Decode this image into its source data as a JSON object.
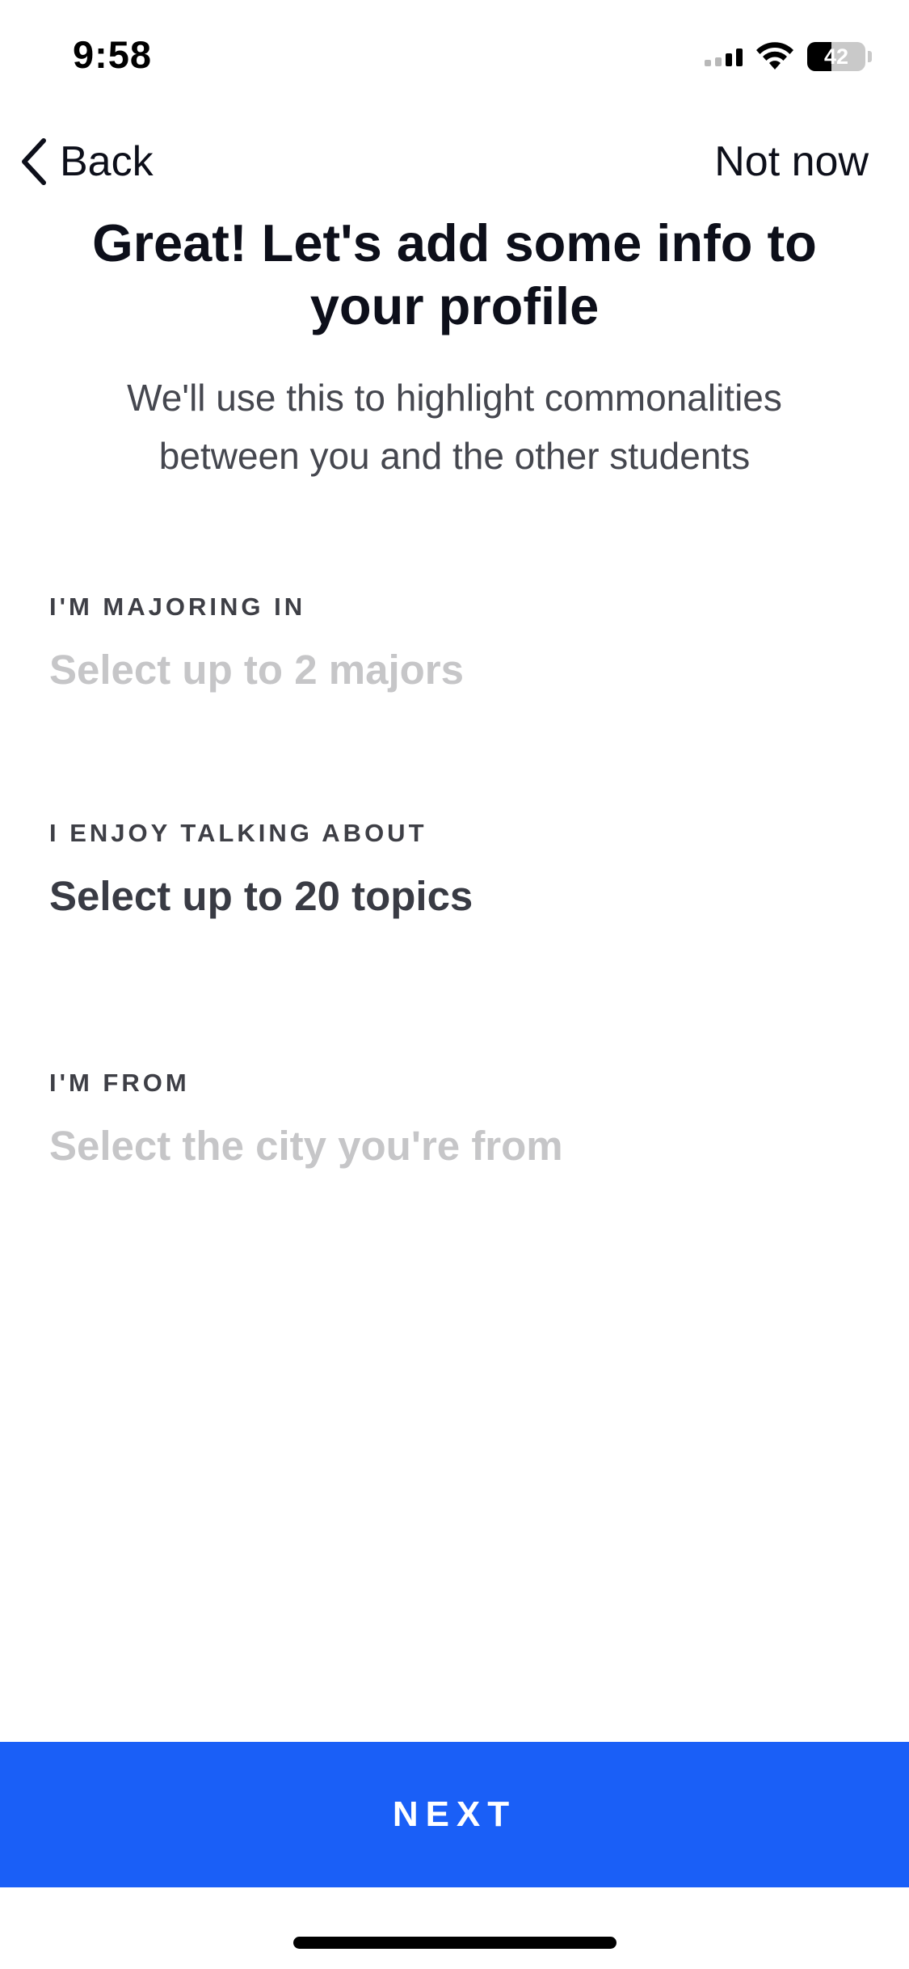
{
  "status_bar": {
    "time": "9:58",
    "battery_level": "42",
    "battery_fraction": 0.42,
    "icons": [
      "cellular-signal-icon",
      "wifi-icon",
      "battery-icon"
    ]
  },
  "nav": {
    "back_label": "Back",
    "back_icon": "chevron-left-icon",
    "skip_label": "Not now"
  },
  "header": {
    "title": "Great! Let's add some info to your profile",
    "subtitle": "We'll use this to highlight commonalities between you and the other students"
  },
  "fields": {
    "major": {
      "label": "I'M MAJORING IN",
      "placeholder": "Select up to 2 majors"
    },
    "topics": {
      "label": "I ENJOY TALKING ABOUT",
      "value": "Select up to 20 topics"
    },
    "hometown": {
      "label": "I'M FROM",
      "placeholder": "Select the city you're from"
    }
  },
  "footer": {
    "next_label": "NEXT"
  },
  "colors": {
    "primary": "#1a5ff7",
    "title_text": "#0d0f1a",
    "placeholder_text": "#c6c6c8",
    "value_text": "#393b44"
  }
}
